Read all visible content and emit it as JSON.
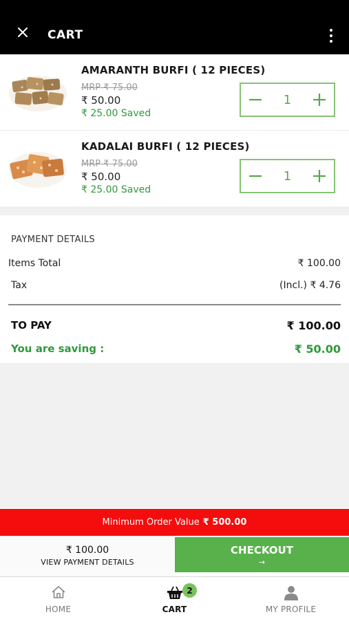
{
  "header": {
    "title": "CART",
    "close_icon": "close-icon",
    "menu_icon": "more-vertical-icon"
  },
  "cart": {
    "items": [
      {
        "name": "AMARANTH BURFI ( 12 PIECES)",
        "mrp": "MRP ₹ 75.00",
        "price": "₹ 50.00",
        "saved": "₹ 25.00 Saved",
        "quantity": "1"
      },
      {
        "name": "KADALAI BURFI ( 12 PIECES)",
        "mrp": "MRP ₹ 75.00",
        "price": "₹ 50.00",
        "saved": "₹ 25.00 Saved",
        "quantity": "1"
      }
    ]
  },
  "payment": {
    "heading": "PAYMENT DETAILS",
    "items_total_label": "Items Total",
    "items_total_value": "₹ 100.00",
    "tax_label": "Tax",
    "tax_value": "(Incl.) ₹ 4.76",
    "to_pay_label": "TO PAY",
    "to_pay_value": "₹ 100.00",
    "saving_label": "You are saving :",
    "saving_value": "₹ 50.00"
  },
  "min_order": {
    "label": "Minimum Order Value",
    "value": "₹ 500.00"
  },
  "checkout_bar": {
    "amount": "₹ 100.00",
    "details_link": "VIEW PAYMENT DETAILS",
    "checkout_label": "CHECKOUT",
    "checkout_arrow": "→"
  },
  "bottom_nav": {
    "home": "HOME",
    "cart": "CART",
    "cart_count": "2",
    "profile": "MY PROFILE"
  },
  "colors": {
    "header_bg": "#000000",
    "accent_green": "#58b14a",
    "saved_green": "#2e9a3a",
    "banner_red": "#f50c0c"
  }
}
